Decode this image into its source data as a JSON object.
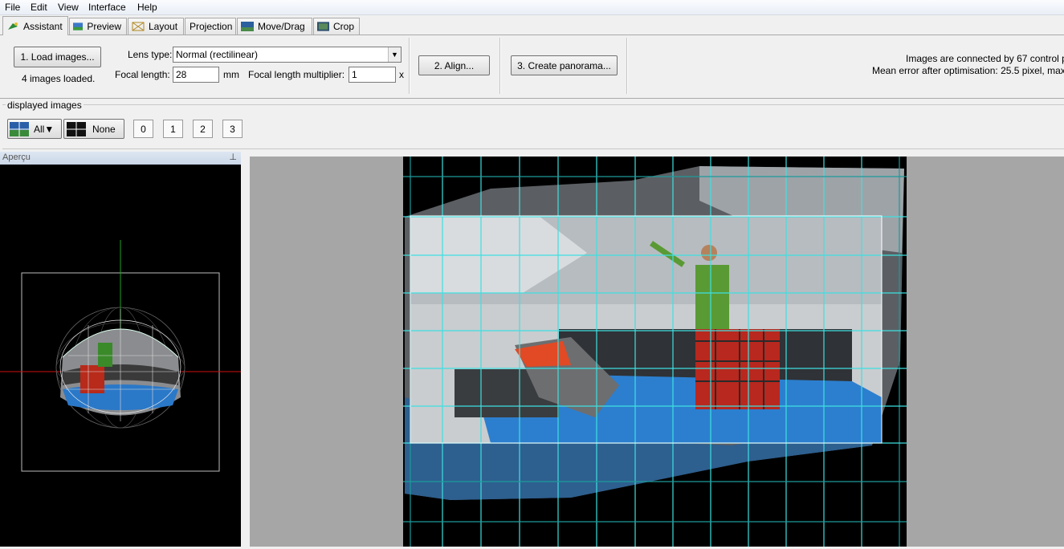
{
  "menubar": {
    "items": [
      "File",
      "Edit",
      "View",
      "Interface",
      "Help"
    ]
  },
  "tabs": [
    {
      "label": "Assistant",
      "icon": "assistant-icon"
    },
    {
      "label": "Preview",
      "icon": "preview-icon"
    },
    {
      "label": "Layout",
      "icon": "layout-icon"
    },
    {
      "label": "Projection",
      "icon": ""
    },
    {
      "label": "Move/Drag",
      "icon": "move-drag-icon"
    },
    {
      "label": "Crop",
      "icon": "crop-icon"
    }
  ],
  "assistant": {
    "load_images_label": "1. Load images...",
    "images_loaded_text": "4 images loaded.",
    "lens_type_label": "Lens type:",
    "lens_type_value": "Normal (rectilinear)",
    "focal_length_label": "Focal length:",
    "focal_length_value": "28",
    "focal_length_unit": "mm",
    "multiplier_label": "Focal length multiplier:",
    "multiplier_value": "1",
    "multiplier_unit": "x",
    "align_label": "2. Align...",
    "create_label": "3. Create panorama...",
    "status_line1": "Images are connected by 67 control p",
    "status_line2": "Mean error after optimisation: 25.5 pixel, max:"
  },
  "displayed_images": {
    "title": "displayed images",
    "all_label": "All▼",
    "none_label": "None",
    "image_numbers": [
      "0",
      "1",
      "2",
      "3"
    ]
  },
  "apercu": {
    "title": "Aperçu",
    "pin_icon": "pin-icon"
  },
  "colors": {
    "grid": "#3ee0e0",
    "grid_dark": "#1c9a9a",
    "axis_x": "#d01010",
    "axis_y": "#20a020"
  }
}
